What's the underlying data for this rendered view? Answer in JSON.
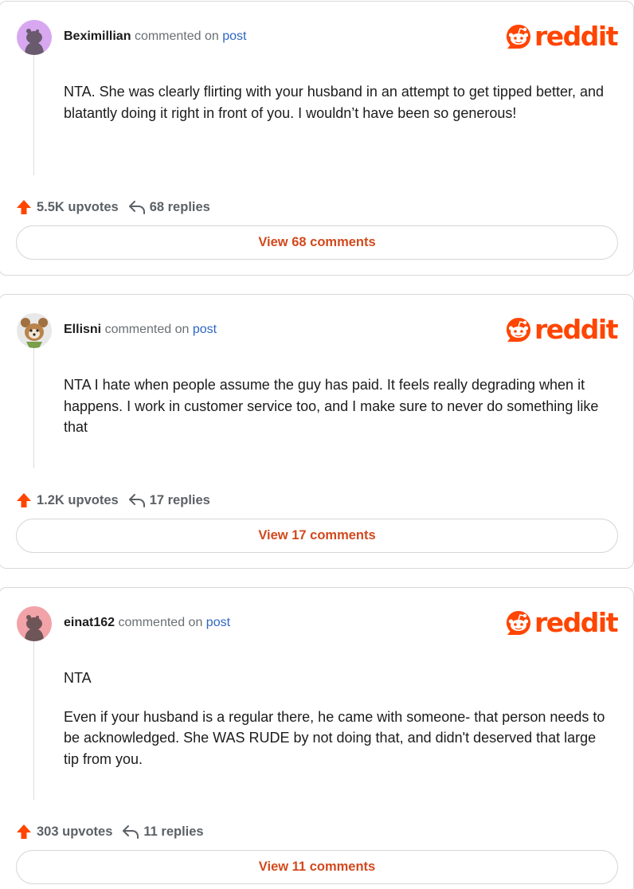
{
  "brand": {
    "wordmark": "reddit",
    "color": "#ff4500",
    "icon": "reddit-snoo-icon"
  },
  "comments": [
    {
      "username": "Beximillian",
      "commented_on": "commented on",
      "post_link": "post",
      "avatar": {
        "icon": "snoo-avatar-icon",
        "color": "#d7a8f0"
      },
      "paragraphs": [
        "NTA. She was clearly flirting with your husband in an attempt to get tipped better, and blatantly doing it right in front of you. I wouldn’t have been so generous!"
      ],
      "upvotes": "5.5K upvotes",
      "replies": "68 replies",
      "view_button": "View 68 comments"
    },
    {
      "username": "Ellisni",
      "commented_on": "commented on",
      "post_link": "post",
      "avatar": {
        "icon": "bear-avatar-icon",
        "color": "#e8e8e8"
      },
      "paragraphs": [
        "NTA I hate when people assume the guy has paid. It feels really degrading when it happens. I work in customer service too, and I make sure to never do something like that"
      ],
      "upvotes": "1.2K upvotes",
      "replies": "17 replies",
      "view_button": "View 17 comments"
    },
    {
      "username": "einat162",
      "commented_on": "commented on",
      "post_link": "post",
      "avatar": {
        "icon": "snoo-avatar-icon",
        "color": "#f1a3a8"
      },
      "paragraphs": [
        "NTA",
        "Even if your husband is a regular there, he came with someone- that person needs to be acknowledged. She WAS RUDE by not doing that, and didn't deserved that large tip from you."
      ],
      "upvotes": "303 upvotes",
      "replies": "11 replies",
      "view_button": "View 11 comments"
    }
  ]
}
